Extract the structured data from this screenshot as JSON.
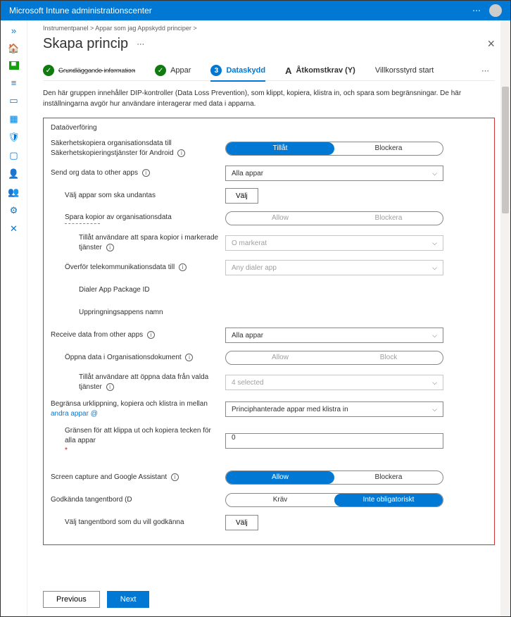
{
  "topbar": {
    "title": "Microsoft Intune administrationscenter"
  },
  "breadcrumb": "Instrumentpanel &gt; Appar som jag Appskydd principer &gt;",
  "page_title": "Skapa princip",
  "wizard": {
    "step1": "Grundläggande information",
    "step2": "Appar",
    "step3_num": "3",
    "step3": "Dataskydd",
    "step4_letter": "A",
    "step4": "Åtkomstkrav (Y)",
    "step5": "Villkorsstyrd start"
  },
  "description": "Den här gruppen innehåller DIP-kontroller (Data Loss Prevention), som klippt, kopiera, klistra in, och spara som begränsningar. De här inställningarna avgör hur användare interagerar med data i apparna.",
  "section1": "Dataöverföring",
  "rows": {
    "backup_label": "Säkerhetskopiera organisationsdata till Säkerhetskopieringstjänster för Android",
    "backup_opt1": "Tillåt",
    "backup_opt2": "Blockera",
    "send_label": "Send org data to other apps",
    "send_value": "Alla appar",
    "exclude_label": "Välj appar som ska undantas",
    "exclude_btn": "Välj",
    "savecopies_label": "Spara kopior av organisationsdata",
    "savecopies_opt1": "Allow",
    "savecopies_opt2": "Blockera",
    "allowsave_label": "Tillåt användare att spara kopior i markerade tjänster",
    "allowsave_value": "O markerat",
    "telecom_label": "Överför telekommunikationsdata till",
    "telecom_value": "Any dialer app",
    "dialerpkg_label": "Dialer App Package ID",
    "dialername_label": "Uppringningsappens namn",
    "receive_label": "Receive data from other apps",
    "receive_value": "Alla appar",
    "opendata_label": "Öppna data i Organisationsdokument",
    "opendata_opt1": "Allow",
    "opendata_opt2": "Block",
    "openfrom_label": "Tillåt användare att öppna data från valda tjänster",
    "openfrom_value": "4 selected",
    "restrict_label_a": "Begränsa urklippning, kopiera och klistra in mellan",
    "restrict_label_b": "andra appar @",
    "restrict_value": "Principhanterade appar med klistra in",
    "charlimit_label": "Gränsen för att klippa ut och kopiera tecken för alla appar",
    "charlimit_value": "0",
    "screen_label": "Screen capture and Google Assistant",
    "screen_opt1": "Allow",
    "screen_opt2": "Blockera",
    "keyboards_label": "Godkända tangentbord (D",
    "keyboards_opt1": "Kräv",
    "keyboards_opt2": "Inte obligatoriskt",
    "selkbd_label": "Välj tangentbord som du vill godkänna",
    "selkbd_btn": "Välj"
  },
  "footer": {
    "prev": "Previous",
    "next": "Next"
  }
}
